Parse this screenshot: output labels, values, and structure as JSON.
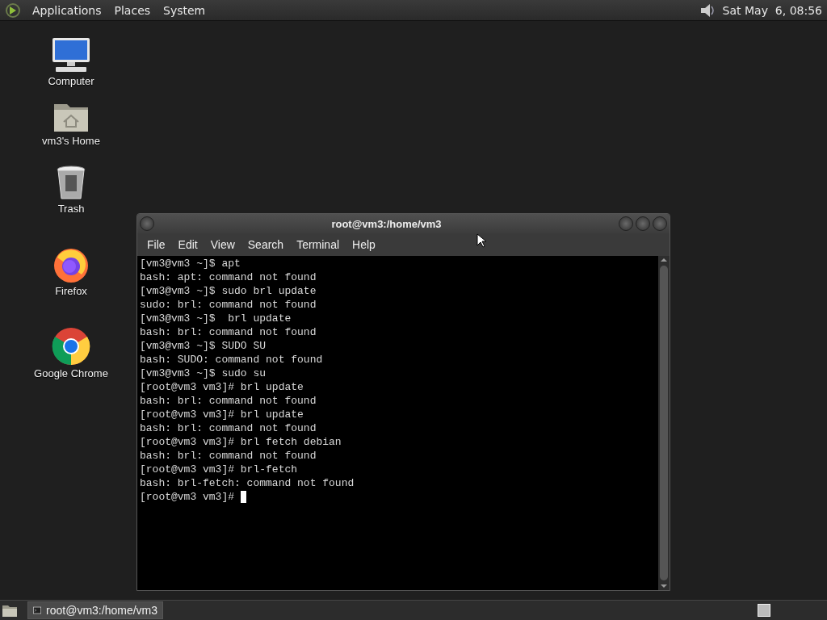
{
  "top_panel": {
    "menus": [
      "Applications",
      "Places",
      "System"
    ],
    "clock": "Sat May  6, 08:56"
  },
  "desktop_icons": [
    {
      "label": "Computer",
      "kind": "computer"
    },
    {
      "label": "vm3's Home",
      "kind": "home"
    },
    {
      "label": "Trash",
      "kind": "trash"
    },
    {
      "label": "Firefox",
      "kind": "firefox"
    },
    {
      "label": "Google Chrome",
      "kind": "chrome"
    }
  ],
  "window": {
    "title": "root@vm3:/home/vm3",
    "menu": [
      "File",
      "Edit",
      "View",
      "Search",
      "Terminal",
      "Help"
    ],
    "terminal_lines": [
      "[vm3@vm3 ~]$ apt",
      "bash: apt: command not found",
      "[vm3@vm3 ~]$ sudo brl update",
      "sudo: brl: command not found",
      "[vm3@vm3 ~]$  brl update",
      "bash: brl: command not found",
      "[vm3@vm3 ~]$ SUDO SU",
      "bash: SUDO: command not found",
      "[vm3@vm3 ~]$ sudo su",
      "[root@vm3 vm3]# brl update",
      "bash: brl: command not found",
      "[root@vm3 vm3]# brl update",
      "bash: brl: command not found",
      "[root@vm3 vm3]# brl fetch debian",
      "bash: brl: command not found",
      "[root@vm3 vm3]# brl-fetch",
      "bash: brl-fetch: command not found",
      "[root@vm3 vm3]# "
    ]
  },
  "taskbar": {
    "items": [
      {
        "label": "root@vm3:/home/vm3",
        "selected": true
      }
    ]
  }
}
